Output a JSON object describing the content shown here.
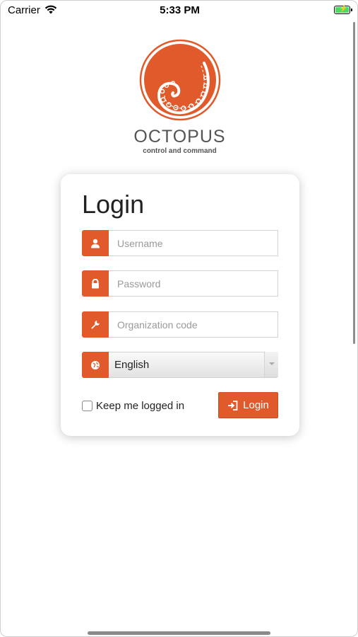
{
  "status_bar": {
    "carrier": "Carrier",
    "time": "5:33 PM"
  },
  "brand": {
    "name": "OCTOPUS",
    "tagline": "control and command",
    "color": "#e05a2b"
  },
  "login": {
    "title": "Login",
    "username_placeholder": "Username",
    "password_placeholder": "Password",
    "org_placeholder": "Organization code",
    "language": "English",
    "keep_logged_in": "Keep me logged in",
    "button_label": "Login"
  }
}
